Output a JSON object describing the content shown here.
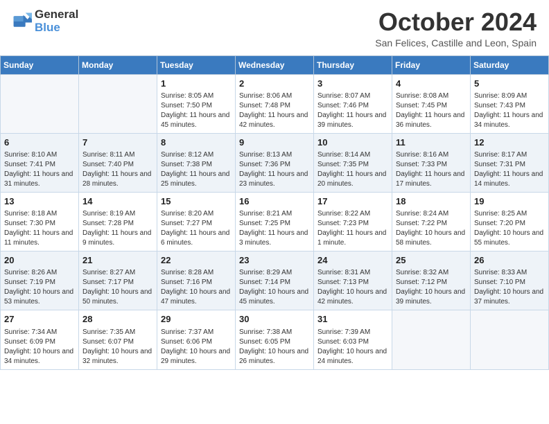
{
  "logo": {
    "text_general": "General",
    "text_blue": "Blue"
  },
  "header": {
    "month_title": "October 2024",
    "subtitle": "San Felices, Castille and Leon, Spain"
  },
  "weekdays": [
    "Sunday",
    "Monday",
    "Tuesday",
    "Wednesday",
    "Thursday",
    "Friday",
    "Saturday"
  ],
  "weeks": [
    [
      {
        "day": "",
        "info": ""
      },
      {
        "day": "",
        "info": ""
      },
      {
        "day": "1",
        "info": "Sunrise: 8:05 AM\nSunset: 7:50 PM\nDaylight: 11 hours and 45 minutes."
      },
      {
        "day": "2",
        "info": "Sunrise: 8:06 AM\nSunset: 7:48 PM\nDaylight: 11 hours and 42 minutes."
      },
      {
        "day": "3",
        "info": "Sunrise: 8:07 AM\nSunset: 7:46 PM\nDaylight: 11 hours and 39 minutes."
      },
      {
        "day": "4",
        "info": "Sunrise: 8:08 AM\nSunset: 7:45 PM\nDaylight: 11 hours and 36 minutes."
      },
      {
        "day": "5",
        "info": "Sunrise: 8:09 AM\nSunset: 7:43 PM\nDaylight: 11 hours and 34 minutes."
      }
    ],
    [
      {
        "day": "6",
        "info": "Sunrise: 8:10 AM\nSunset: 7:41 PM\nDaylight: 11 hours and 31 minutes."
      },
      {
        "day": "7",
        "info": "Sunrise: 8:11 AM\nSunset: 7:40 PM\nDaylight: 11 hours and 28 minutes."
      },
      {
        "day": "8",
        "info": "Sunrise: 8:12 AM\nSunset: 7:38 PM\nDaylight: 11 hours and 25 minutes."
      },
      {
        "day": "9",
        "info": "Sunrise: 8:13 AM\nSunset: 7:36 PM\nDaylight: 11 hours and 23 minutes."
      },
      {
        "day": "10",
        "info": "Sunrise: 8:14 AM\nSunset: 7:35 PM\nDaylight: 11 hours and 20 minutes."
      },
      {
        "day": "11",
        "info": "Sunrise: 8:16 AM\nSunset: 7:33 PM\nDaylight: 11 hours and 17 minutes."
      },
      {
        "day": "12",
        "info": "Sunrise: 8:17 AM\nSunset: 7:31 PM\nDaylight: 11 hours and 14 minutes."
      }
    ],
    [
      {
        "day": "13",
        "info": "Sunrise: 8:18 AM\nSunset: 7:30 PM\nDaylight: 11 hours and 11 minutes."
      },
      {
        "day": "14",
        "info": "Sunrise: 8:19 AM\nSunset: 7:28 PM\nDaylight: 11 hours and 9 minutes."
      },
      {
        "day": "15",
        "info": "Sunrise: 8:20 AM\nSunset: 7:27 PM\nDaylight: 11 hours and 6 minutes."
      },
      {
        "day": "16",
        "info": "Sunrise: 8:21 AM\nSunset: 7:25 PM\nDaylight: 11 hours and 3 minutes."
      },
      {
        "day": "17",
        "info": "Sunrise: 8:22 AM\nSunset: 7:23 PM\nDaylight: 11 hours and 1 minute."
      },
      {
        "day": "18",
        "info": "Sunrise: 8:24 AM\nSunset: 7:22 PM\nDaylight: 10 hours and 58 minutes."
      },
      {
        "day": "19",
        "info": "Sunrise: 8:25 AM\nSunset: 7:20 PM\nDaylight: 10 hours and 55 minutes."
      }
    ],
    [
      {
        "day": "20",
        "info": "Sunrise: 8:26 AM\nSunset: 7:19 PM\nDaylight: 10 hours and 53 minutes."
      },
      {
        "day": "21",
        "info": "Sunrise: 8:27 AM\nSunset: 7:17 PM\nDaylight: 10 hours and 50 minutes."
      },
      {
        "day": "22",
        "info": "Sunrise: 8:28 AM\nSunset: 7:16 PM\nDaylight: 10 hours and 47 minutes."
      },
      {
        "day": "23",
        "info": "Sunrise: 8:29 AM\nSunset: 7:14 PM\nDaylight: 10 hours and 45 minutes."
      },
      {
        "day": "24",
        "info": "Sunrise: 8:31 AM\nSunset: 7:13 PM\nDaylight: 10 hours and 42 minutes."
      },
      {
        "day": "25",
        "info": "Sunrise: 8:32 AM\nSunset: 7:12 PM\nDaylight: 10 hours and 39 minutes."
      },
      {
        "day": "26",
        "info": "Sunrise: 8:33 AM\nSunset: 7:10 PM\nDaylight: 10 hours and 37 minutes."
      }
    ],
    [
      {
        "day": "27",
        "info": "Sunrise: 7:34 AM\nSunset: 6:09 PM\nDaylight: 10 hours and 34 minutes."
      },
      {
        "day": "28",
        "info": "Sunrise: 7:35 AM\nSunset: 6:07 PM\nDaylight: 10 hours and 32 minutes."
      },
      {
        "day": "29",
        "info": "Sunrise: 7:37 AM\nSunset: 6:06 PM\nDaylight: 10 hours and 29 minutes."
      },
      {
        "day": "30",
        "info": "Sunrise: 7:38 AM\nSunset: 6:05 PM\nDaylight: 10 hours and 26 minutes."
      },
      {
        "day": "31",
        "info": "Sunrise: 7:39 AM\nSunset: 6:03 PM\nDaylight: 10 hours and 24 minutes."
      },
      {
        "day": "",
        "info": ""
      },
      {
        "day": "",
        "info": ""
      }
    ]
  ]
}
